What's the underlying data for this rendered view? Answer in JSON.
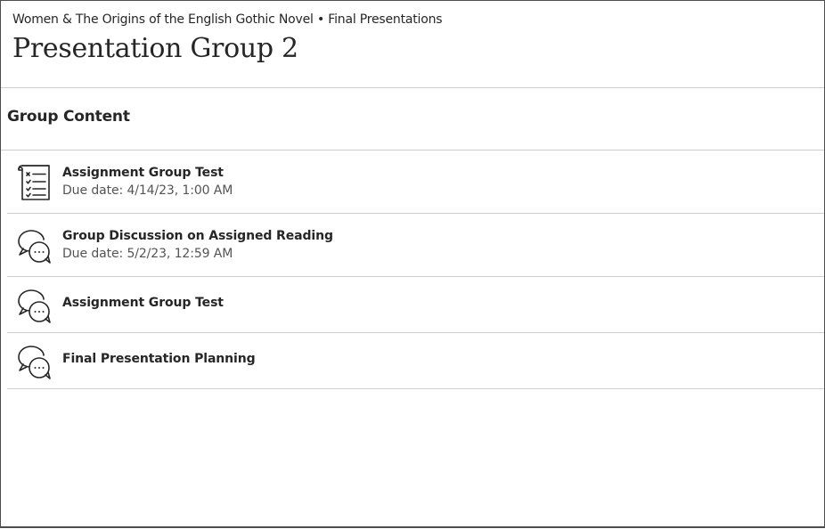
{
  "header": {
    "breadcrumb": "Women & The Origins of the English Gothic Novel • Final Presentations",
    "title": "Presentation Group 2"
  },
  "section": {
    "title": "Group Content"
  },
  "items": [
    {
      "title": "Assignment Group Test",
      "due": "Due date: 4/14/23, 1:00 AM",
      "icon": "assignment-checklist-icon"
    },
    {
      "title": "Group Discussion on Assigned Reading",
      "due": "Due date: 5/2/23, 12:59 AM",
      "icon": "discussion-bubbles-icon"
    },
    {
      "title": "Assignment Group Test",
      "due": "",
      "icon": "discussion-bubbles-icon"
    },
    {
      "title": "Final Presentation Planning",
      "due": "",
      "icon": "discussion-bubbles-icon"
    }
  ]
}
